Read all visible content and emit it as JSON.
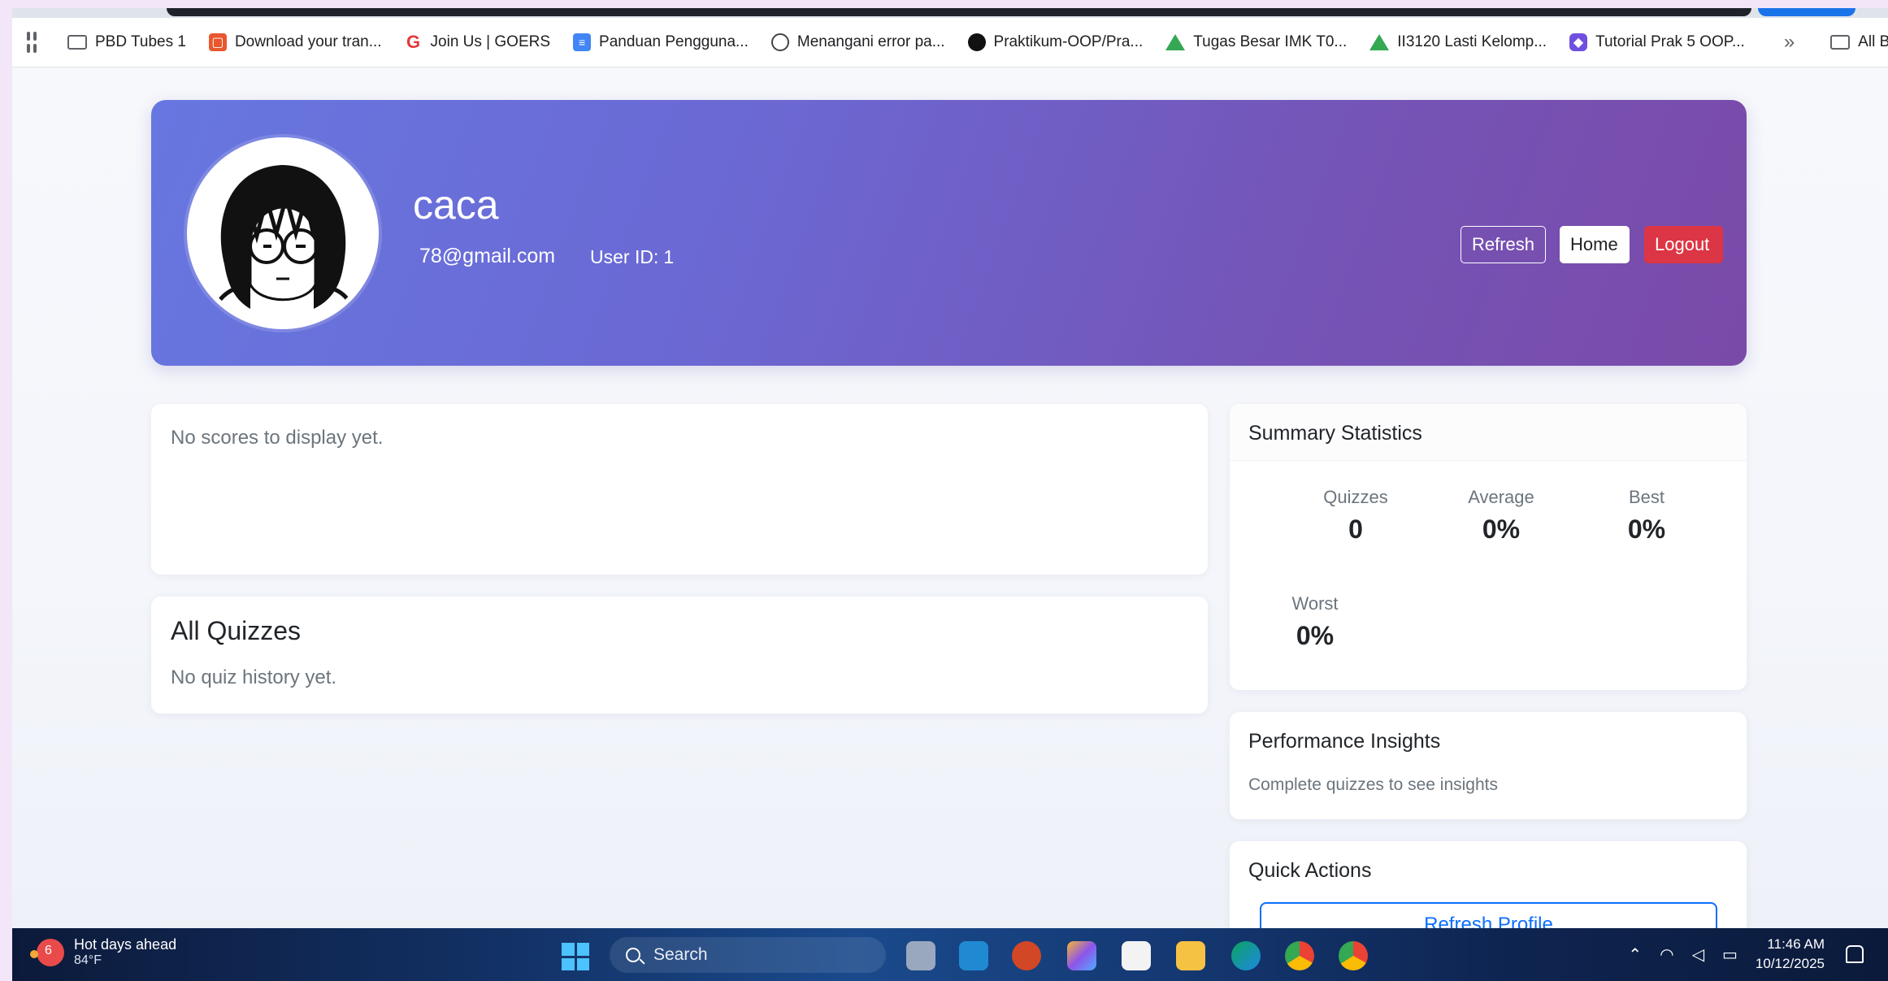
{
  "bookmarks": [
    {
      "label": "PBD Tubes 1",
      "icon": "folder-icon"
    },
    {
      "label": "Download your tran...",
      "icon": "download-app-icon"
    },
    {
      "label": "Join Us | GOERS",
      "icon": "goers-icon"
    },
    {
      "label": "Panduan Pengguna...",
      "icon": "google-docs-icon"
    },
    {
      "label": "Menangani error pa...",
      "icon": "chatgpt-icon"
    },
    {
      "label": "Praktikum-OOP/Pra...",
      "icon": "github-icon"
    },
    {
      "label": "Tugas Besar IMK T0...",
      "icon": "google-drive-icon"
    },
    {
      "label": "II3120 Lasti Kelomp...",
      "icon": "google-drive-icon"
    },
    {
      "label": "Tutorial Prak 5 OOP...",
      "icon": "canva-icon"
    }
  ],
  "bookmarks_more": "»",
  "bookmarks_all": "All Bookmarks",
  "profile": {
    "username": "caca",
    "email": "78@gmail.com",
    "user_id_label": "User ID:",
    "user_id": "1"
  },
  "header_buttons": {
    "refresh": "Refresh",
    "home": "Home",
    "logout": "Logout"
  },
  "scores": {
    "empty_text": "No scores to display yet."
  },
  "quizzes": {
    "title": "All Quizzes",
    "empty_text": "No quiz history yet."
  },
  "summary": {
    "title": "Summary Statistics",
    "stats": [
      {
        "label": "Quizzes",
        "value": "0"
      },
      {
        "label": "Average",
        "value": "0%"
      },
      {
        "label": "Best",
        "value": "0%"
      },
      {
        "label": "Worst",
        "value": "0%"
      }
    ]
  },
  "insights": {
    "title": "Performance Insights",
    "text": "Complete quizzes to see insights"
  },
  "actions": {
    "title": "Quick Actions",
    "refresh_profile": "Refresh Profile"
  },
  "taskbar": {
    "weather_title": "Hot days ahead",
    "weather_temp": "84°F",
    "weather_badge": "6",
    "search_placeholder": "Search",
    "time": "11:46 AM",
    "date": "10/12/2025"
  },
  "colors": {
    "hero_gradient_start": "#6777e0",
    "hero_gradient_end": "#7a4aa8",
    "logout": "#dc3545",
    "primary": "#0d6efd"
  }
}
